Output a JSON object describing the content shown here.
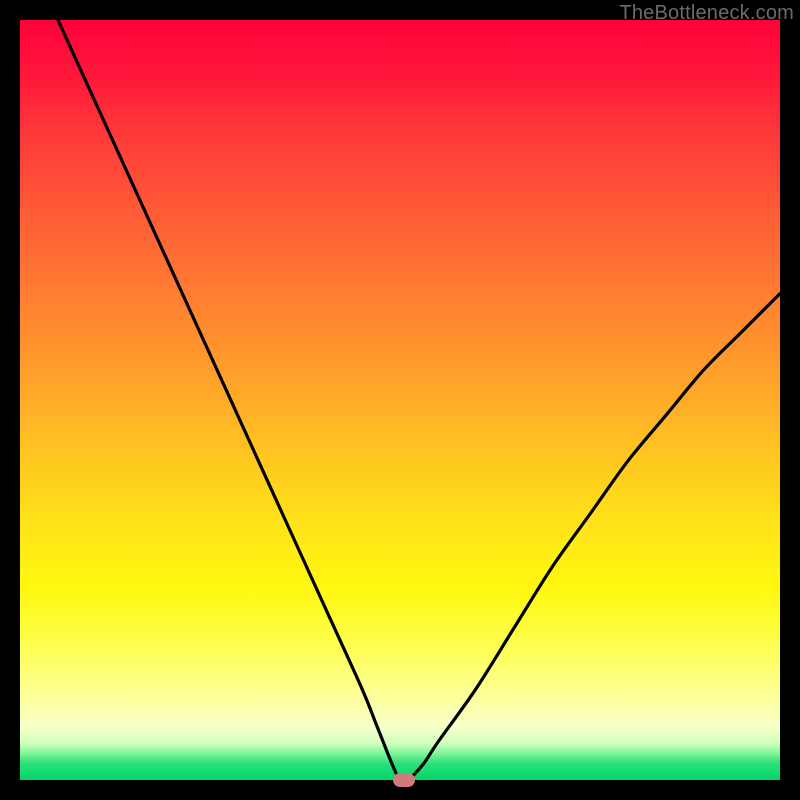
{
  "watermark": "TheBottleneck.com",
  "colors": {
    "frame": "#000000",
    "watermark": "#6b6b6b",
    "curve": "#000000",
    "marker": "#d17a7e",
    "gradient_top": "#ff003a",
    "gradient_bottom": "#00d66a"
  },
  "chart_data": {
    "type": "line",
    "title": "",
    "xlabel": "",
    "ylabel": "",
    "xlim": [
      0,
      100
    ],
    "ylim": [
      0,
      100
    ],
    "grid": false,
    "legend": false,
    "series": [
      {
        "name": "bottleneck-curve",
        "x": [
          5,
          10,
          15,
          20,
          25,
          30,
          35,
          40,
          45,
          47,
          49,
          50,
          51,
          53,
          55,
          60,
          65,
          70,
          75,
          80,
          85,
          90,
          95,
          100
        ],
        "y": [
          100,
          89,
          78,
          67,
          56,
          45,
          34,
          23,
          12,
          7,
          2,
          0,
          0,
          2,
          5,
          12,
          20,
          28,
          35,
          42,
          48,
          54,
          59,
          64
        ]
      }
    ],
    "annotations": [
      {
        "name": "optimal-marker",
        "x": 50.5,
        "y": 0
      }
    ]
  }
}
